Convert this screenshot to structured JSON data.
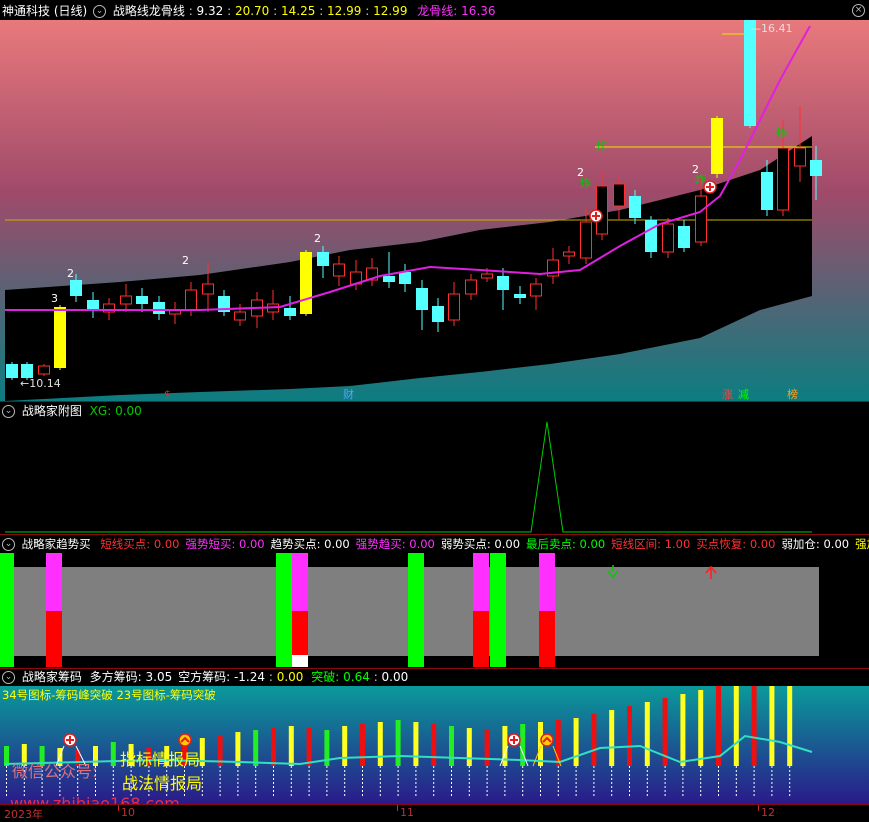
{
  "main": {
    "stock": "神通科技 (日线)",
    "indicator": "战略线龙骨线",
    "values": [
      "9.32",
      "20.70",
      "14.25",
      "12.99",
      "12.99"
    ],
    "dragon_label": "龙骨线",
    "dragon_value": "16.36",
    "high_price": "16.41",
    "low_price": "10.14",
    "bar_labels": [
      {
        "text": "3",
        "color": "#ffffff"
      },
      {
        "text": "2",
        "color": "#ffffff"
      },
      {
        "text": "2",
        "color": "#ffffff"
      },
      {
        "text": "2",
        "color": "#ffffff"
      },
      {
        "text": "2",
        "color": "#ffffff"
      },
      {
        "text": "2",
        "color": "#ffffff"
      },
      {
        "text": "炸",
        "color": "#00cc00"
      },
      {
        "text": "炸",
        "color": "#00cc00"
      },
      {
        "text": "炸",
        "color": "#00cc00"
      },
      {
        "text": "炸",
        "color": "#00cc00"
      }
    ],
    "event_tags": [
      {
        "text": "$",
        "color": "#ff2020"
      },
      {
        "text": "财",
        "color": "#5aa0ff"
      },
      {
        "text": "涨",
        "color": "#ff4040"
      },
      {
        "text": "减",
        "color": "#00ff00"
      },
      {
        "text": "榜",
        "color": "#ffa020"
      }
    ],
    "colors": {
      "up": "#ff3030",
      "down": "#54ffff",
      "ma": "#e020e0",
      "yellow": "#ffff00"
    }
  },
  "pane2": {
    "title": "战略家附图",
    "xg_label": "XG:",
    "xg_value": "0.00"
  },
  "pane3": {
    "title": "战略家趋势买",
    "signals": [
      {
        "label": "短线买点:",
        "value": "0.00",
        "color": "#ff3030"
      },
      {
        "label": "强势短买:",
        "value": "0.00",
        "color": "#ff30ff"
      },
      {
        "label": "趋势买点:",
        "value": "0.00",
        "color": "#ffffff"
      },
      {
        "label": "强势趋买:",
        "value": "0.00",
        "color": "#ff30ff"
      },
      {
        "label": "弱势买点:",
        "value": "0.00",
        "color": "#ffffff"
      },
      {
        "label": "最后卖点:",
        "value": "0.00",
        "color": "#00ff00"
      },
      {
        "label": "短线区间:",
        "value": "1.00",
        "color": "#ff3030"
      },
      {
        "label": "买点恢复:",
        "value": "0.00",
        "color": "#ff3030"
      },
      {
        "label": "弱加仓:",
        "value": "0.00",
        "color": "#ffffff"
      },
      {
        "label": "强加仓:",
        "value": "",
        "color": "#ffff00"
      }
    ]
  },
  "pane4": {
    "title": "战略家筹码",
    "long_label": "多方筹码:",
    "long_value": "3.05",
    "short_label": "空方筹码:",
    "short_value": "-1.24",
    "v3": "0.00",
    "break_label": "突破:",
    "break_value": "0.64",
    "v5": "0.00",
    "legend": "34号图标-筹码峰突破 23号图标-筹码突破",
    "watermark1": "微信公众号:",
    "watermark2": "指标情报局",
    "watermark3": "战法情报局",
    "watermark4": "www.zhibiao168.com",
    "axis_labels": [
      "2023年",
      "10",
      "11",
      "12"
    ]
  }
}
